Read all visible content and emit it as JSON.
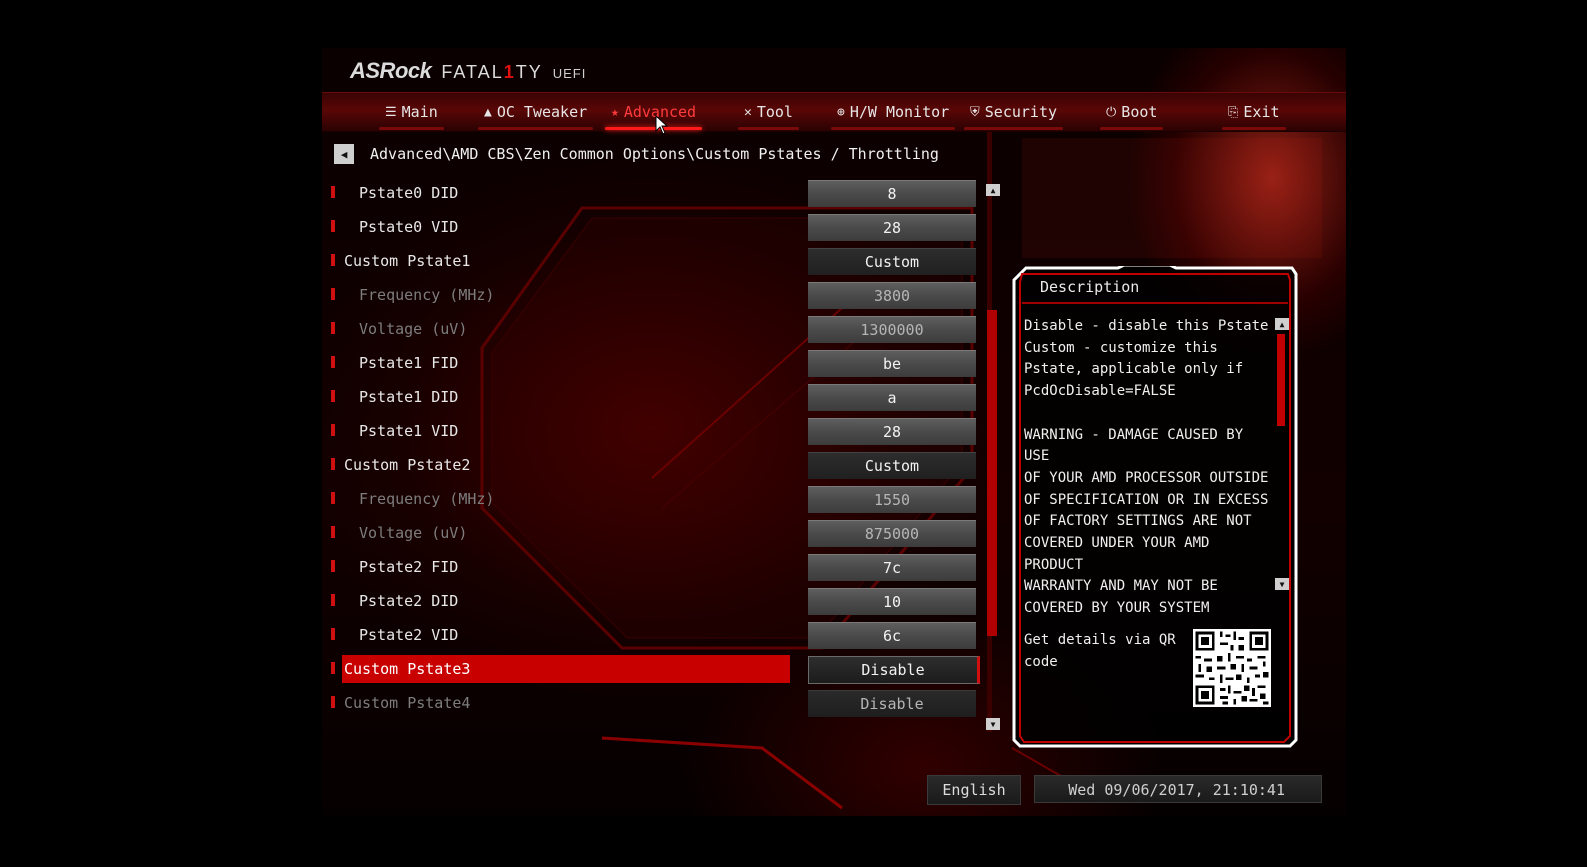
{
  "brand": {
    "maker": "ASRock",
    "series_pre": "FATAL",
    "series_one": "1",
    "series_post": "TY",
    "uefi": "UEFI"
  },
  "nav": {
    "tabs": [
      {
        "label": "Main",
        "icon": "list-icon",
        "active": false
      },
      {
        "label": "OC Tweaker",
        "icon": "rocket-icon",
        "active": false
      },
      {
        "label": "Advanced",
        "icon": "star-icon",
        "active": true
      },
      {
        "label": "Tool",
        "icon": "tools-icon",
        "active": false
      },
      {
        "label": "H/W Monitor",
        "icon": "monitor-icon",
        "active": false
      },
      {
        "label": "Security",
        "icon": "shield-icon",
        "active": false
      },
      {
        "label": "Boot",
        "icon": "power-icon",
        "active": false
      },
      {
        "label": "Exit",
        "icon": "exit-icon",
        "active": false
      }
    ]
  },
  "breadcrumb": "Advanced\\AMD CBS\\Zen Common Options\\Custom Pstates / Throttling",
  "settings": [
    {
      "label": "Pstate0 DID",
      "value": "8"
    },
    {
      "label": "Pstate0 VID",
      "value": "28"
    },
    {
      "label": "Custom Pstate1",
      "value": "Custom"
    },
    {
      "label": "Frequency (MHz)",
      "value": "3800"
    },
    {
      "label": "Voltage (uV)",
      "value": "1300000"
    },
    {
      "label": "Pstate1 FID",
      "value": "be"
    },
    {
      "label": "Pstate1 DID",
      "value": "a"
    },
    {
      "label": "Pstate1 VID",
      "value": "28"
    },
    {
      "label": "Custom Pstate2",
      "value": "Custom"
    },
    {
      "label": "Frequency (MHz)",
      "value": "1550"
    },
    {
      "label": "Voltage (uV)",
      "value": "875000"
    },
    {
      "label": "Pstate2 FID",
      "value": "7c"
    },
    {
      "label": "Pstate2 DID",
      "value": "10"
    },
    {
      "label": "Pstate2 VID",
      "value": "6c"
    },
    {
      "label": "Custom Pstate3",
      "value": "Disable"
    },
    {
      "label": "Custom Pstate4",
      "value": "Disable"
    }
  ],
  "description": {
    "title": "Description",
    "text": "Disable - disable this Pstate\nCustom - customize this\nPstate, applicable only if\nPcdOcDisable=FALSE\n\nWARNING - DAMAGE CAUSED BY USE\nOF YOUR AMD PROCESSOR OUTSIDE\nOF SPECIFICATION OR IN EXCESS\nOF FACTORY SETTINGS ARE NOT\nCOVERED UNDER YOUR AMD PRODUCT\nWARRANTY AND MAY NOT BE\nCOVERED BY YOUR SYSTEM",
    "qr_text": "Get details via QR code"
  },
  "footer": {
    "language": "English",
    "datetime": "Wed 09/06/2017, 21:10:41"
  },
  "colors": {
    "accent": "#d01010",
    "active_tab": "#ff3b3b",
    "selection": "#c80000"
  }
}
